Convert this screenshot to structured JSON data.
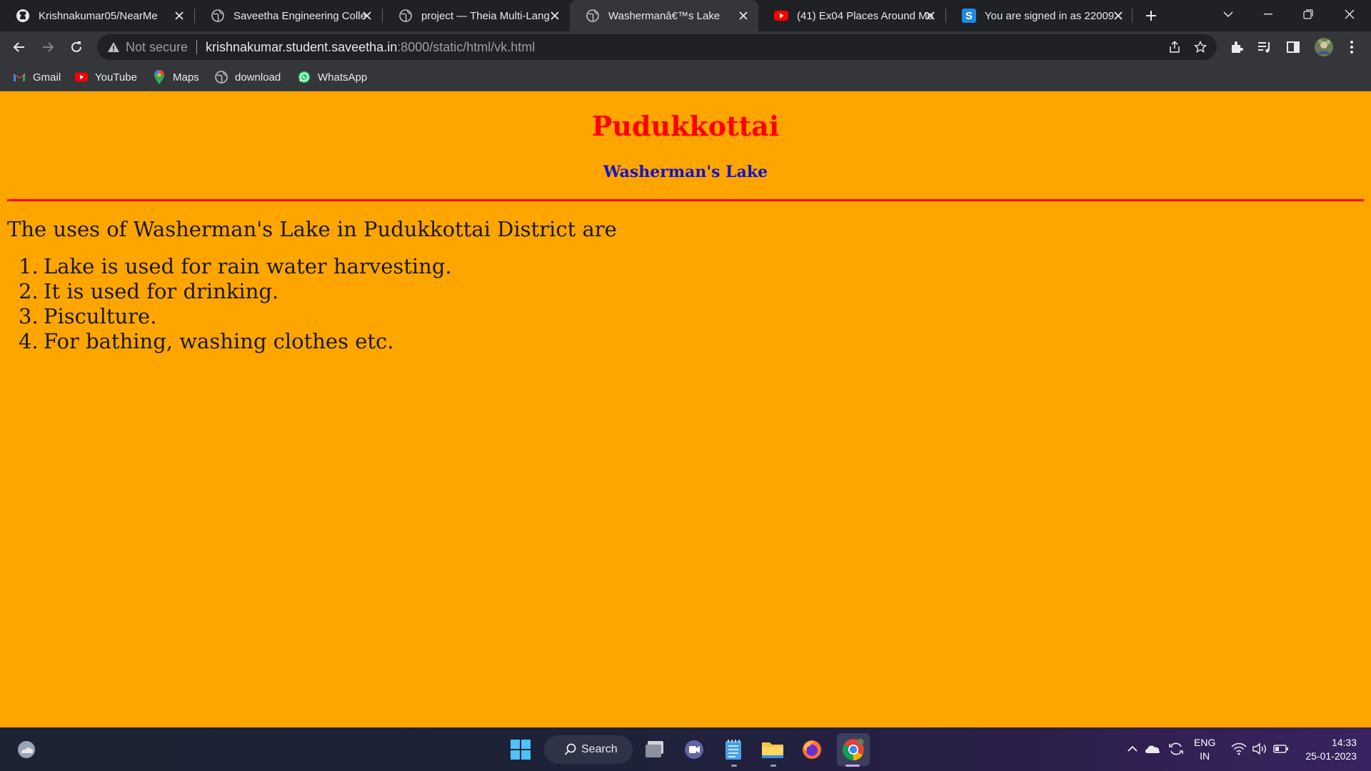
{
  "browser": {
    "tabs": [
      {
        "title": "Krishnakumar05/NearMe",
        "icon": "github-icon"
      },
      {
        "title": "Saveetha Engineering Colle",
        "icon": "globe-icon"
      },
      {
        "title": "project — Theia Multi-Lang",
        "icon": "globe-icon"
      },
      {
        "title": "Washermanâ€™s Lake",
        "icon": "globe-icon",
        "active": true
      },
      {
        "title": "(41) Ex04 Places Around Mo",
        "icon": "youtube-icon"
      },
      {
        "title": "You are signed in as 22009",
        "icon": "s-icon"
      }
    ],
    "address": {
      "security": "Not secure",
      "host": "krishnakumar.student.saveetha.in",
      "path": ":8000/static/html/vk.html"
    },
    "bookmarks": [
      {
        "label": "Gmail",
        "icon": "gmail-icon"
      },
      {
        "label": "YouTube",
        "icon": "youtube-icon"
      },
      {
        "label": "Maps",
        "icon": "maps-icon"
      },
      {
        "label": "download",
        "icon": "globe-icon"
      },
      {
        "label": "WhatsApp",
        "icon": "whatsapp-icon"
      }
    ]
  },
  "page": {
    "title": "Pudukkottai",
    "subtitle": "Washerman's Lake",
    "intro": "The uses of Washerman's Lake in Pudukkottai District are",
    "uses": [
      {
        "num": "1.",
        "text": "Lake is used for rain water harvesting."
      },
      {
        "num": "2.",
        "text": "It is used for drinking."
      },
      {
        "num": "3.",
        "text": "Pisculture."
      },
      {
        "num": "4.",
        "text": "For bathing, washing clothes etc."
      }
    ],
    "colors": {
      "background": "#ffa500",
      "title": "#ff0000",
      "subtitle": "#1414c8",
      "rule": "#ff0000"
    }
  },
  "taskbar": {
    "search_label": "Search",
    "language": {
      "line1": "ENG",
      "line2": "IN"
    },
    "clock": {
      "time": "14:33",
      "date": "25-01-2023"
    }
  }
}
